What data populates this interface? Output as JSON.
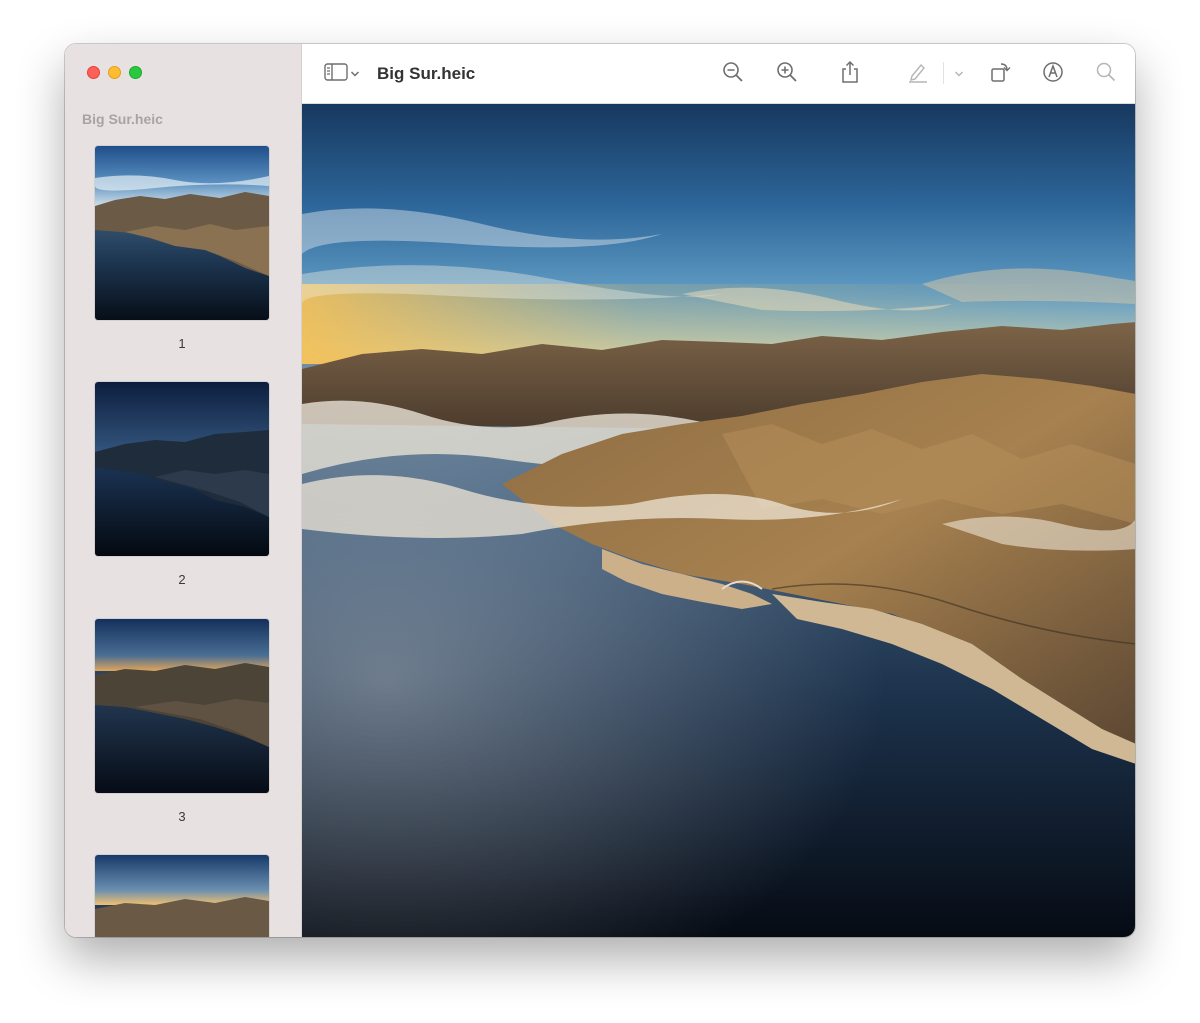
{
  "window": {
    "title": "Big Sur.heic"
  },
  "sidebar": {
    "title": "Big Sur.heic",
    "pages": [
      {
        "label": "1"
      },
      {
        "label": "2"
      },
      {
        "label": "3"
      },
      {
        "label": ""
      }
    ]
  },
  "toolbar": {
    "icons": [
      "sidebar-icon",
      "chevron-down-icon",
      "zoom-out-icon",
      "zoom-in-icon",
      "share-icon",
      "highlight-icon",
      "chevron-down-icon",
      "rotate-icon",
      "markup-icon",
      "search-icon"
    ]
  },
  "colors": {
    "sidebar_bg": "#e7e1e2",
    "close": "#fe5f57",
    "minimize": "#febc2e",
    "zoom": "#28c840"
  }
}
